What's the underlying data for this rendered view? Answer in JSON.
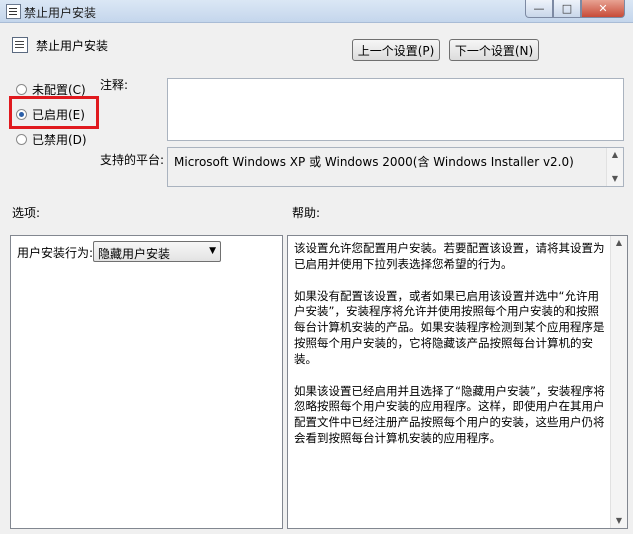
{
  "window": {
    "title": "禁止用户安装",
    "controls": {
      "minimize": "—",
      "maximize": "□",
      "close": "✕"
    }
  },
  "header": {
    "policy_name": "禁止用户安装",
    "prev_button": "上一个设置(P)",
    "next_button": "下一个设置(N)"
  },
  "state_options": [
    {
      "label": "未配置(C)",
      "selected": false
    },
    {
      "label": "已启用(E)",
      "selected": true
    },
    {
      "label": "已禁用(D)",
      "selected": false
    }
  ],
  "comment": {
    "label": "注释:",
    "value": ""
  },
  "platform": {
    "label": "支持的平台:",
    "value": "Microsoft Windows XP 或 Windows 2000(含 Windows Installer v2.0)"
  },
  "options_section": {
    "label": "选项:",
    "field_label": "用户安装行为:",
    "selected_value": "隐藏用户安装"
  },
  "help_section": {
    "label": "帮助:",
    "paragraphs": [
      "该设置允许您配置用户安装。若要配置该设置，请将其设置为已启用并使用下拉列表选择您希望的行为。",
      "如果没有配置该设置，或者如果已启用该设置并选中“允许用户安装”，安装程序将允许并使用按照每个用户安装的和按照每台计算机安装的产品。如果安装程序检测到某个应用程序是按照每个用户安装的，它将隐藏该产品按照每台计算机的安装。",
      "如果该设置已经启用并且选择了“隐藏用户安装”，安装程序将忽略按照每个用户安装的应用程序。这样，即使用户在其用户配置文件中已经注册产品按照每个用户的安装，这些用户仍将会看到按照每台计算机安装的应用程序。"
    ]
  },
  "accent_colors": {
    "highlight_box": "#e0191e",
    "radio_dot": "#2c5fa8"
  }
}
